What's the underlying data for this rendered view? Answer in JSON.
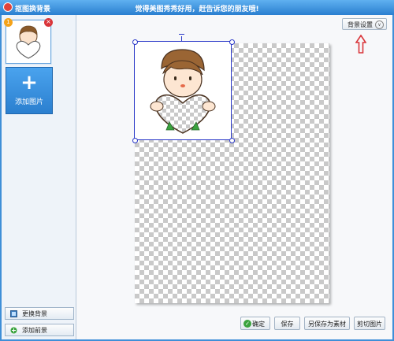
{
  "window": {
    "title": "抠图换背景",
    "promo": "觉得美图秀秀好用，赶告诉您的朋友哦!"
  },
  "sidebar": {
    "thumb_badge": "1",
    "add_image_label": "添加图片",
    "replace_bg_label": "更换背景",
    "add_fg_label": "添加前景"
  },
  "canvas": {
    "bg_settings_label": "背景设置"
  },
  "footer": {
    "ok_label": "确定",
    "save_label": "保存",
    "save_as_material_label": "另保存为素材",
    "cut_image_label": "剪切图片"
  },
  "colors": {
    "accent": "#2a7fd0",
    "selection": "#2a38c8",
    "hint_arrow": "#d9353a"
  }
}
